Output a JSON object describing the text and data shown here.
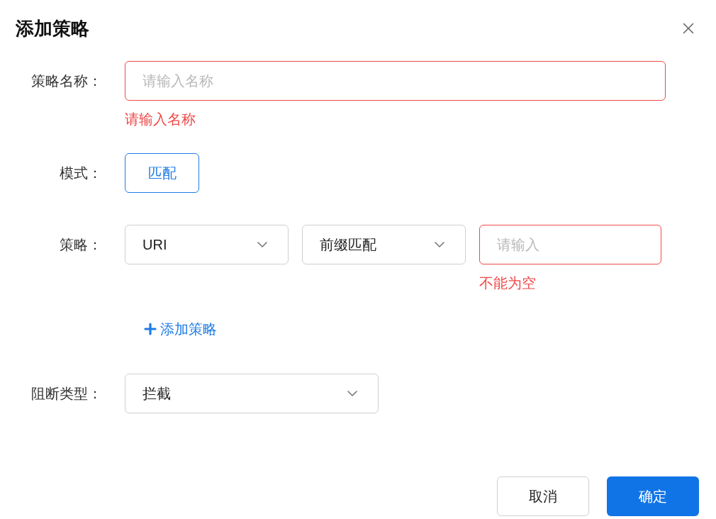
{
  "dialog": {
    "title": "添加策略"
  },
  "name_field": {
    "label": "策略名称：",
    "placeholder": "请输入名称",
    "invalid": true,
    "error": "请输入名称"
  },
  "mode": {
    "label": "模式：",
    "options": [
      {
        "label": "匹配",
        "selected": true
      }
    ]
  },
  "strategy": {
    "label": "策略：",
    "rules": [
      {
        "field": "URI",
        "match": "前缀匹配",
        "value_placeholder": "请输入",
        "invalid": true,
        "error": "不能为空"
      }
    ],
    "add_link": "添加策略"
  },
  "block_type": {
    "label": "阻断类型：",
    "value": "拦截"
  },
  "buttons": [
    {
      "label": "取消",
      "kind": "secondary"
    },
    {
      "label": "确定",
      "kind": "primary"
    }
  ]
}
